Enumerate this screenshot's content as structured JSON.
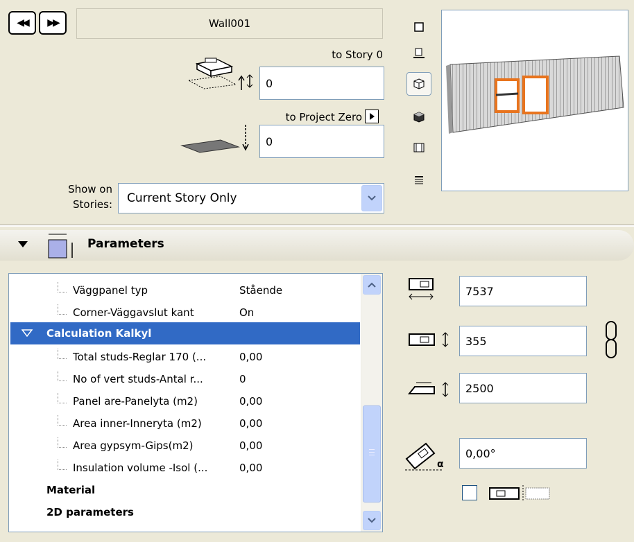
{
  "header": {
    "prev_label": "◀◀",
    "next_label": "▶▶",
    "element_name": "Wall001"
  },
  "elevation": {
    "to_story_label": "to Story 0",
    "to_story_value": "0",
    "to_project_zero_label": "to Project Zero",
    "to_project_zero_value": "0"
  },
  "show_on_stories": {
    "label_line1": "Show on",
    "label_line2": "Stories:",
    "selected": "Current Story Only"
  },
  "panel": {
    "title": "Parameters"
  },
  "tree": {
    "rows": [
      {
        "name": "Väggpanel typ",
        "value": "Stående"
      },
      {
        "name": "Corner-Väggavslut kant",
        "value": "On"
      }
    ],
    "selected_group": "Calculation Kalkyl",
    "calc_rows": [
      {
        "name": "Total studs-Reglar 170 (...",
        "value": "0,00"
      },
      {
        "name": "No of vert studs-Antal r...",
        "value": "0"
      },
      {
        "name": "Panel are-Panelyta (m2)",
        "value": "0,00"
      },
      {
        "name": "Area inner-Inneryta (m2)",
        "value": "0,00"
      },
      {
        "name": "Area gypsym-Gips(m2)",
        "value": "0,00"
      },
      {
        "name": "Insulation volume -Isol (...",
        "value": "0,00"
      }
    ],
    "group_material": "Material",
    "group_2d": "2D parameters"
  },
  "dimensions": {
    "length": "7537",
    "thickness": "355",
    "height": "2500",
    "angle": "0,00°"
  },
  "colors": {
    "selection": "#316ac5",
    "accent_window": "#e8741e",
    "background": "#ece9d8"
  }
}
